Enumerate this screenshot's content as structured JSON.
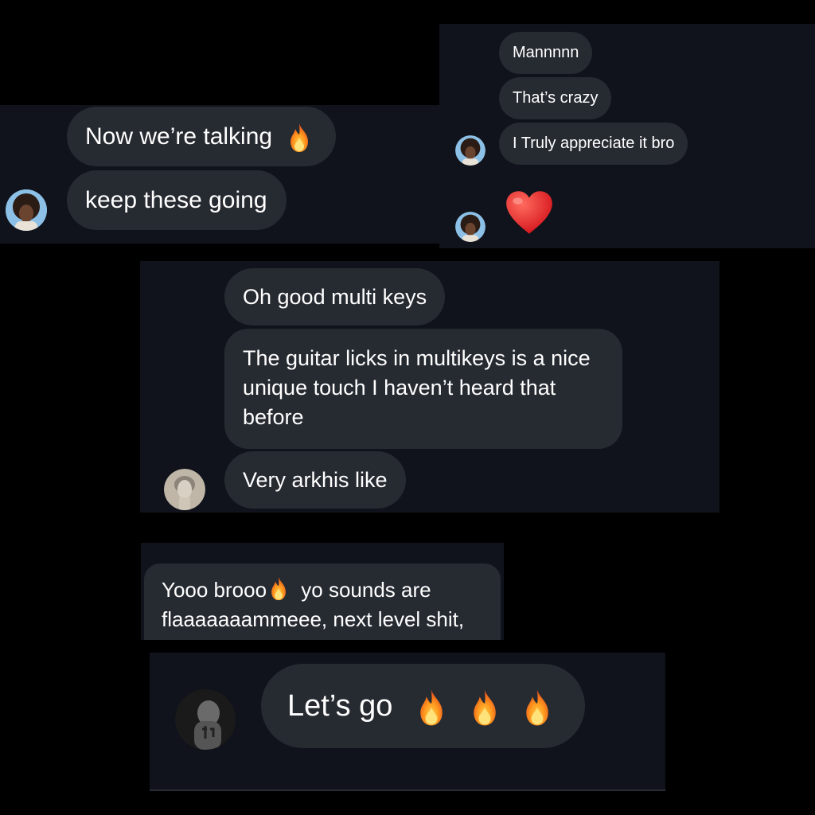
{
  "panels": [
    {
      "id": "panel-1",
      "messages": [
        {
          "text": "Now we’re talking",
          "emoji": "fire"
        },
        {
          "text": "keep these going"
        }
      ],
      "avatar": "curly-hair-avatar"
    },
    {
      "id": "panel-2",
      "messages": [
        {
          "text": "Mannnnn"
        },
        {
          "text": "That’s crazy"
        },
        {
          "text": "I Truly appreciate it bro"
        },
        {
          "emoji": "heart"
        }
      ],
      "avatar": "curly-hair-avatar"
    },
    {
      "id": "panel-3",
      "messages": [
        {
          "text": "Oh good multi keys"
        },
        {
          "text": "The guitar licks in multikeys is a nice unique touch I haven’t heard that before"
        },
        {
          "text": "Very arkhis like"
        }
      ],
      "avatar": "statue-avatar"
    },
    {
      "id": "panel-4",
      "messages": [
        {
          "text_before": "Yooo brooo",
          "emoji": "fire",
          "text_after": " yo sounds are flaaaaaaammeee, next level shit,"
        }
      ]
    },
    {
      "id": "panel-5",
      "messages": [
        {
          "text": "Let’s go",
          "emoji": [
            "fire",
            "fire",
            "fire"
          ]
        }
      ],
      "avatar": "tattoo-avatar"
    }
  ],
  "colors": {
    "page": "#000000",
    "panel": "#10131b",
    "bubble": "#262a31",
    "text": "#ffffff"
  }
}
